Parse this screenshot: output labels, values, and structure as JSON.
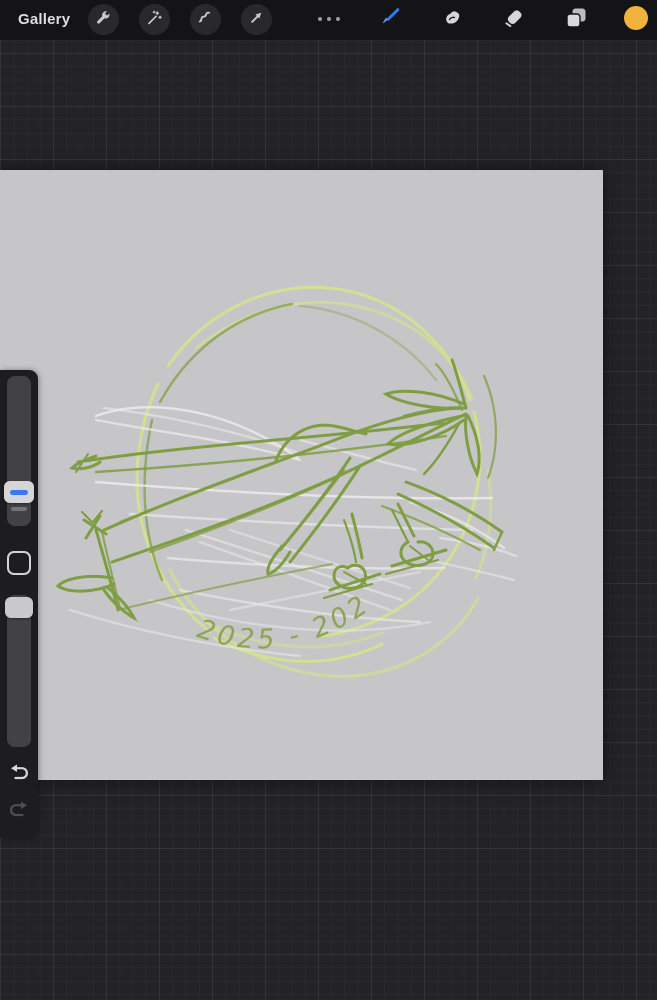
{
  "header": {
    "gallery_label": "Gallery",
    "left_tools": [
      {
        "id": "actions",
        "icon": "wrench-icon"
      },
      {
        "id": "adjustments",
        "icon": "magic-wand-icon"
      },
      {
        "id": "selection",
        "icon": "selection-s-icon"
      },
      {
        "id": "transform",
        "icon": "transform-arrow-icon"
      }
    ],
    "right_tools": [
      {
        "id": "canvas-options",
        "icon": "ellipsis-icon"
      },
      {
        "id": "paint",
        "icon": "paint-brush-icon",
        "active": true
      },
      {
        "id": "smudge",
        "icon": "smudge-icon"
      },
      {
        "id": "erase",
        "icon": "eraser-icon"
      },
      {
        "id": "layers",
        "icon": "layers-icon"
      },
      {
        "id": "color",
        "icon": "color-swatch",
        "value": "#f1b33d"
      }
    ],
    "accent_color": "#2e7bf6"
  },
  "sidebar": {
    "sliders": [
      {
        "name": "brush-size",
        "handle_accent": "#3a78f2"
      },
      {
        "name": "opacity",
        "handle_accent": "#c9c9cb"
      }
    ],
    "buttons": [
      "modify",
      "undo",
      "redo"
    ]
  },
  "canvas": {
    "background_color": "#c6c6c8",
    "caption_text": "2025 - 202",
    "sketch_subject": "propeller airplane sketch inside circular emblem",
    "sketch_colors": {
      "olive": "#7c9b3b",
      "light_green": "#d3e38d",
      "white": "#ededef"
    }
  }
}
